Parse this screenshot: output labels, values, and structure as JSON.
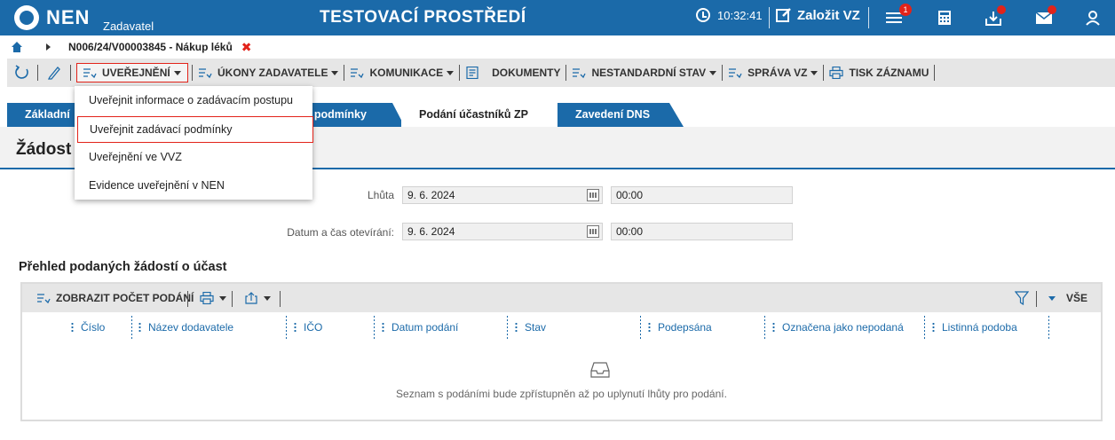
{
  "header": {
    "logo_text": "NEN",
    "logo_sub": "Zadavatel",
    "env_title": "TESTOVACÍ PROSTŘEDÍ",
    "clock": "10:32:41",
    "new_button": "Založit VZ",
    "notifications_count": "1",
    "brand_color": "#1b6aa9",
    "alert_color": "#e2231a"
  },
  "breadcrumb": {
    "label": "N006/24/V00003845 - Nákup léků",
    "close": "✖"
  },
  "toolbar": {
    "uverejneni": "UVEŘEJNĚNÍ",
    "ukony": "ÚKONY ZADAVATELE",
    "komunikace": "KOMUNIKACE",
    "dokumenty": "DOKUMENTY",
    "nestandardni": "NESTANDARDNÍ STAV",
    "sprava": "SPRÁVA VZ",
    "tisk": "TISK ZÁZNAMU"
  },
  "dropdown": {
    "items": [
      "Uveřejnit informace o zadávacím postupu",
      "Uveřejnit zadávací podmínky",
      "Uveřejnění ve VVZ",
      "Evidence uveřejnění v NEN"
    ]
  },
  "tabs": {
    "zakladni": "Základní",
    "podminky": "cí podmínky",
    "podani": "Podání účastníků ZP",
    "dns": "Zavedení DNS"
  },
  "section": {
    "title": "Žádost o"
  },
  "form": {
    "lhuta_label": "Lhůta",
    "lhuta_date": "9. 6. 2024",
    "lhuta_time": "00:00",
    "otevirani_label": "Datum a čas otevírání:",
    "otevirani_date": "9. 6. 2024",
    "otevirani_time": "00:00"
  },
  "overview": {
    "title": "Přehled podaných žádostí o účast",
    "toolbar_button": "ZOBRAZIT POČET PODÁNÍ",
    "filter_all": "VŠE",
    "columns": [
      "Číslo",
      "Název dodavatele",
      "IČO",
      "Datum podání",
      "Stav",
      "Podepsána",
      "Označena jako nepodaná",
      "Listinná podoba"
    ],
    "empty_text": "Seznam s podáními bude zpřístupněn až po uplynutí lhůty pro podání."
  }
}
